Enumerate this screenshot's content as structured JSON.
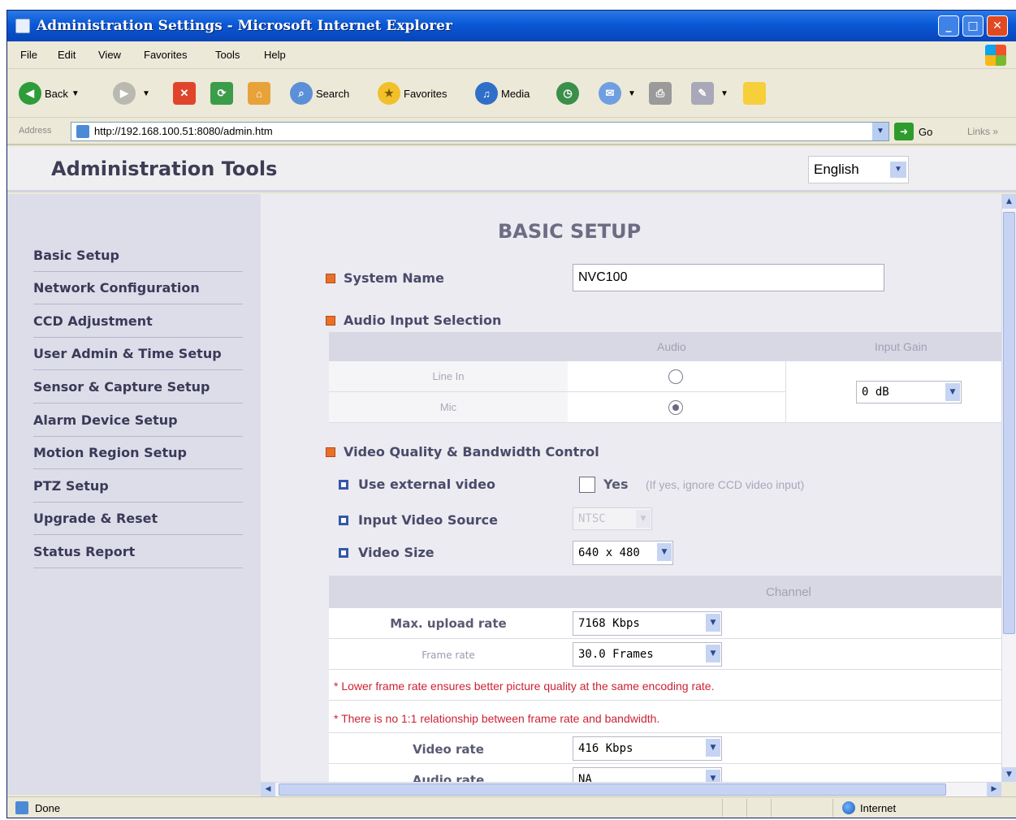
{
  "window": {
    "title": "Administration Settings - Microsoft Internet Explorer"
  },
  "menu": [
    "File",
    "Edit",
    "View",
    "Favorites",
    "Tools",
    "Help"
  ],
  "toolbar": {
    "back": "Back",
    "search": "Search",
    "favorites": "Favorites",
    "media": "Media"
  },
  "address": {
    "label": "Address",
    "url": "http://192.168.100.51:8080/admin.htm",
    "go": "Go",
    "links": "Links"
  },
  "header": {
    "title": "Administration Tools",
    "language": "English"
  },
  "sidebar": {
    "items": [
      "Basic Setup",
      "Network Configuration",
      "CCD Adjustment",
      "User Admin & Time Setup",
      "Sensor & Capture Setup",
      "Alarm Device Setup",
      "Motion Region Setup",
      "PTZ Setup",
      "Upgrade & Reset",
      "Status Report"
    ]
  },
  "main": {
    "section_title": "BASIC SETUP",
    "system_name": {
      "label": "System Name",
      "value": "NVC100"
    },
    "audio": {
      "heading": "Audio Input Selection",
      "col_audio": "Audio",
      "col_gain": "Input Gain",
      "rows": [
        {
          "label": "Line In",
          "checked": false
        },
        {
          "label": "Mic",
          "checked": true
        }
      ],
      "gain": "0 dB"
    },
    "video": {
      "heading": "Video Quality & Bandwidth Control",
      "external": {
        "label": "Use external video",
        "option": "Yes",
        "hint": "(If yes, ignore CCD video input)"
      },
      "source": {
        "label": "Input Video Source",
        "value": "NTSC"
      },
      "size": {
        "label": "Video Size",
        "value": "640 x 480"
      },
      "channel_header": "Channel",
      "max_upload": {
        "label": "Max. upload rate",
        "value": "7168 Kbps"
      },
      "frame_rate": {
        "label": "Frame rate",
        "value": "30.0 Frames"
      },
      "note1": "* Lower frame rate ensures better picture quality at the same encoding rate.",
      "note2": "* There is no 1:1 relationship between frame rate and bandwidth.",
      "video_rate": {
        "label": "Video rate",
        "value": "416 Kbps"
      },
      "audio_rate": {
        "label": "Audio rate",
        "value": "NA"
      }
    }
  },
  "status": {
    "text": "Done",
    "zone": "Internet"
  }
}
